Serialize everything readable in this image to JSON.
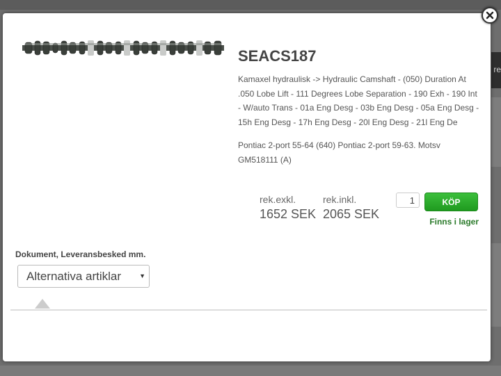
{
  "background": {
    "partial_text": "re"
  },
  "modal": {
    "close_icon": "close-icon",
    "product_image_alt": "camshaft image",
    "title": "SEACS187",
    "description": "Kamaxel hydraulisk -> Hydraulic Camshaft - (050) Duration At .050 Lobe Lift - 111 Degrees Lobe Separation - 190 Exh - 190 Int - W/auto Trans - 01a Eng Desg - 03b Eng Desg - 05a Eng Desg - 15h Eng Desg - 17h Eng Desg - 20l Eng Desg - 21l Eng De",
    "fitment": "Pontiac 2-port 55-64 (640) Pontiac 2-port 59-63. Motsv GM518111 (A)",
    "price_excl_label": "rek.exkl.",
    "price_excl_value": "1652 SEK",
    "price_incl_label": "rek.inkl.",
    "price_incl_value": "2065 SEK",
    "quantity": "1",
    "buy_label": "KÖP",
    "stock_status": "Finns i lager",
    "documents_heading": "Dokument, Leveransbesked mm.",
    "select_value": "Alternativa artiklar"
  },
  "colors": {
    "buy_button": "#2aad2a",
    "stock_text": "#2a7a2a",
    "title_text": "#444444"
  }
}
